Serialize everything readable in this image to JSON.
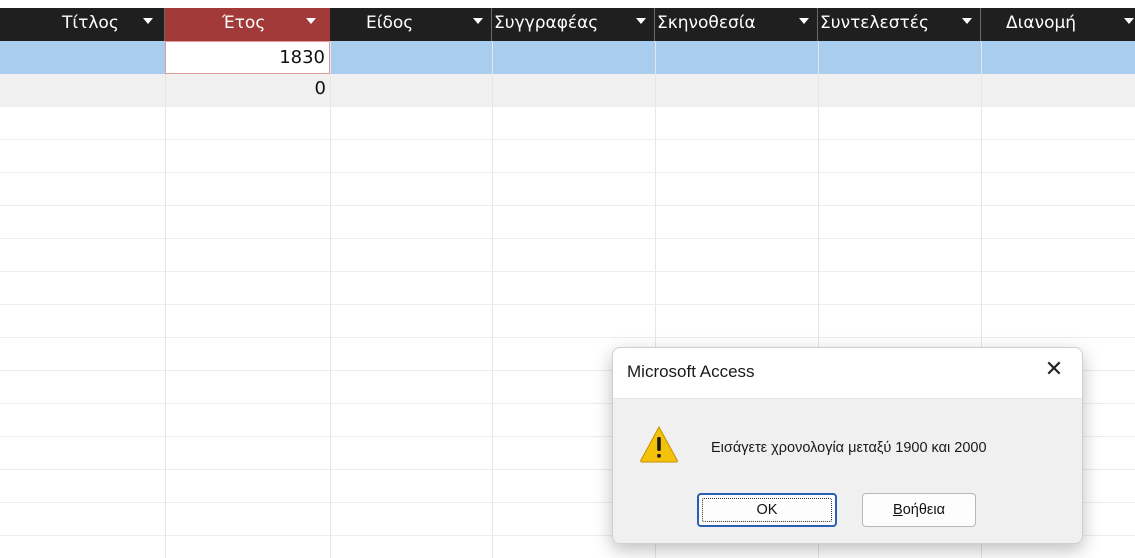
{
  "columns": [
    {
      "label": "Τίτλος"
    },
    {
      "label": "Έτος"
    },
    {
      "label": "Είδος"
    },
    {
      "label": "Συγγραφέας"
    },
    {
      "label": "Σκηνοθεσία"
    },
    {
      "label": "Συντελεστές"
    },
    {
      "label": "Διανομή"
    }
  ],
  "rows": [
    {
      "year": "1830"
    },
    {
      "year": "0"
    }
  ],
  "dialog": {
    "title": "Microsoft Access",
    "close": "✕",
    "message": "Εισάγετε χρονολογία μεταξύ 1900 και 2000",
    "ok_label": "OK",
    "help_first": "Β",
    "help_rest": "οήθεια"
  },
  "colors": {
    "header_bg": "#1f1f1f",
    "active_header": "#a33a3a",
    "selected_row": "#a9cdee",
    "ok_border": "#2b5fb3",
    "warning": "#f5c20a"
  },
  "icons": {
    "warning": "warning-icon",
    "close": "close-icon",
    "filter": "filter-dropdown-icon"
  }
}
